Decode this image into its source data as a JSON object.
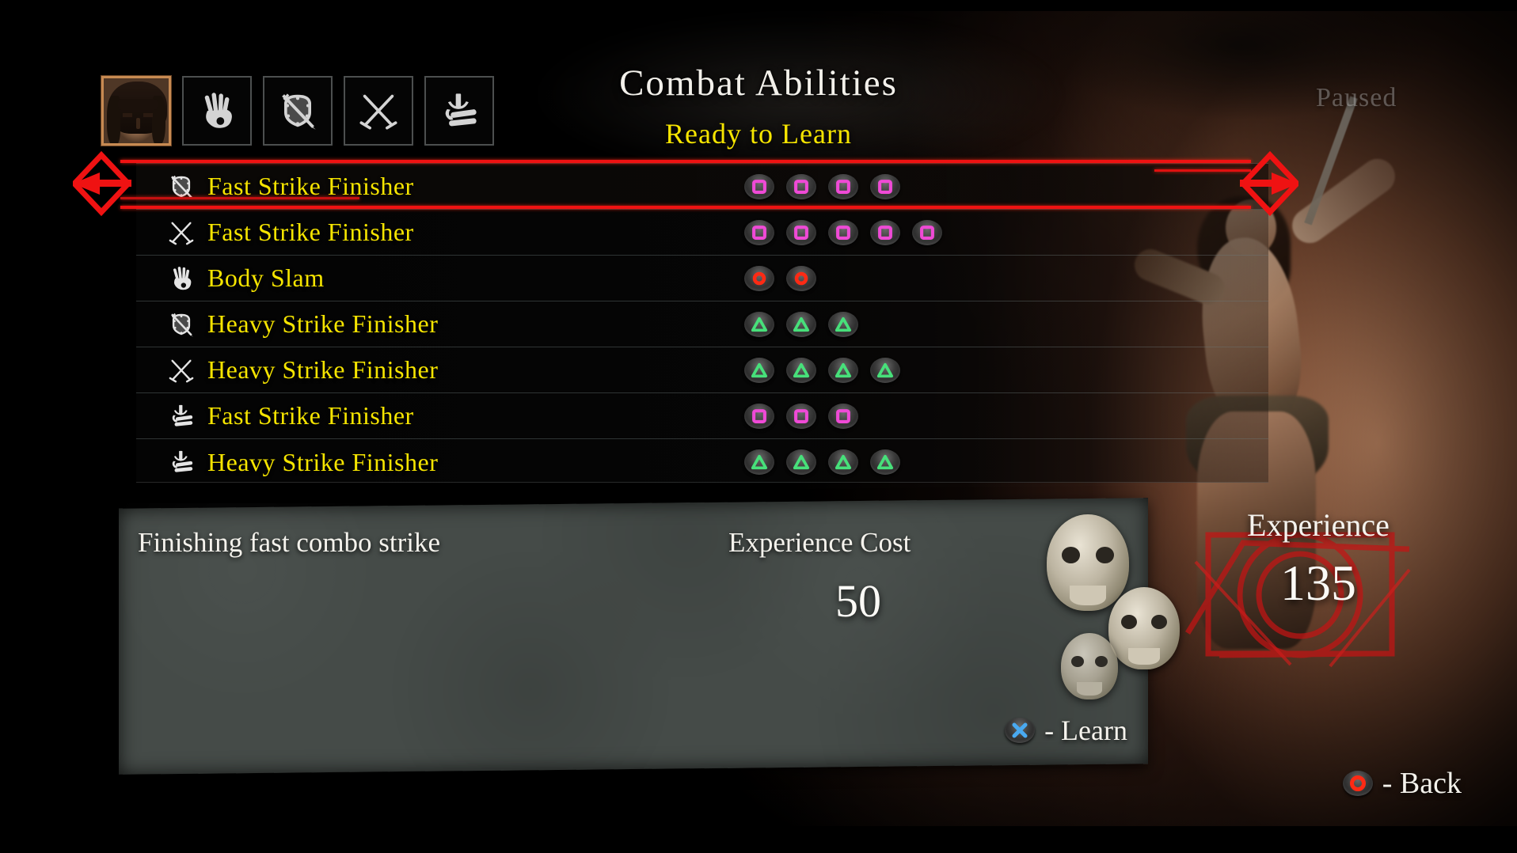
{
  "header": {
    "title": "Combat Abilities",
    "subtitle": "Ready to Learn",
    "paused_label": "Paused"
  },
  "tabs": [
    {
      "id": "portrait",
      "icon": "character-portrait-icon",
      "label": "Character",
      "selected": true
    },
    {
      "id": "unarmed",
      "icon": "open-hand-icon",
      "label": "Unarmed",
      "selected": false
    },
    {
      "id": "shield",
      "icon": "shield-and-sword-icon",
      "label": "Shield",
      "selected": false
    },
    {
      "id": "dual",
      "icon": "crossed-swords-icon",
      "label": "Dual Wield",
      "selected": false
    },
    {
      "id": "weapons",
      "icon": "weapon-rack-icon",
      "label": "Weapons",
      "selected": false
    }
  ],
  "abilities": [
    {
      "icon": "shield-and-sword-icon",
      "name": "Fast Strike Finisher",
      "button": "square",
      "count": 4,
      "selected": true
    },
    {
      "icon": "crossed-swords-icon",
      "name": "Fast Strike Finisher",
      "button": "square",
      "count": 5,
      "selected": false
    },
    {
      "icon": "open-hand-icon",
      "name": "Body Slam",
      "button": "circle",
      "count": 2,
      "selected": false
    },
    {
      "icon": "shield-and-sword-icon",
      "name": "Heavy Strike Finisher",
      "button": "triangle",
      "count": 3,
      "selected": false
    },
    {
      "icon": "crossed-swords-icon",
      "name": "Heavy Strike Finisher",
      "button": "triangle",
      "count": 4,
      "selected": false
    },
    {
      "icon": "weapon-rack-icon",
      "name": "Fast Strike Finisher",
      "button": "square",
      "count": 3,
      "selected": false
    },
    {
      "icon": "weapon-rack-icon",
      "name": "Heavy Strike Finisher",
      "button": "triangle",
      "count": 4,
      "selected": false
    }
  ],
  "info": {
    "description": "Finishing fast combo strike",
    "cost_label": "Experience Cost",
    "cost_value": "50",
    "learn_prompt": "- Learn",
    "learn_button_icon": "playstation-cross-icon"
  },
  "experience": {
    "label": "Experience",
    "value": "135"
  },
  "footer": {
    "back_prompt": "- Back",
    "back_button_icon": "playstation-circle-icon"
  },
  "colors": {
    "square_button": "#ef4ad6",
    "triangle_button": "#47e07a",
    "circle_button": "#ff2a14",
    "cross_button": "#49a9f0",
    "highlight_yellow": "#f5e400",
    "selection_red": "#ef1212"
  }
}
